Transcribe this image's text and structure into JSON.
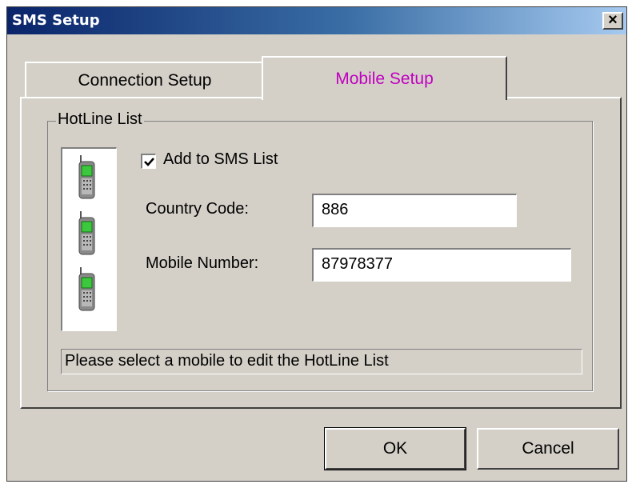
{
  "window": {
    "title": "SMS Setup",
    "close_label": "×"
  },
  "tabs": [
    {
      "label": "Connection Setup",
      "active": false
    },
    {
      "label": "Mobile Setup",
      "active": true
    }
  ],
  "hotline": {
    "group_title": "HotLine List",
    "phone_icons": [
      "mobile-phone-icon",
      "mobile-phone-icon",
      "mobile-phone-icon"
    ],
    "add_to_sms": {
      "label": "Add to SMS List",
      "checked": true
    },
    "country_code": {
      "label": "Country Code:",
      "value": "886"
    },
    "mobile_number": {
      "label": "Mobile Number:",
      "value": "87978377"
    },
    "status": "Please select a mobile to edit the HotLine List"
  },
  "buttons": {
    "ok": "OK",
    "cancel": "Cancel"
  },
  "colors": {
    "title_start": "#0a246a",
    "title_end": "#a6caf0",
    "active_tab_text": "#c000c0",
    "face": "#d4d0c8"
  }
}
